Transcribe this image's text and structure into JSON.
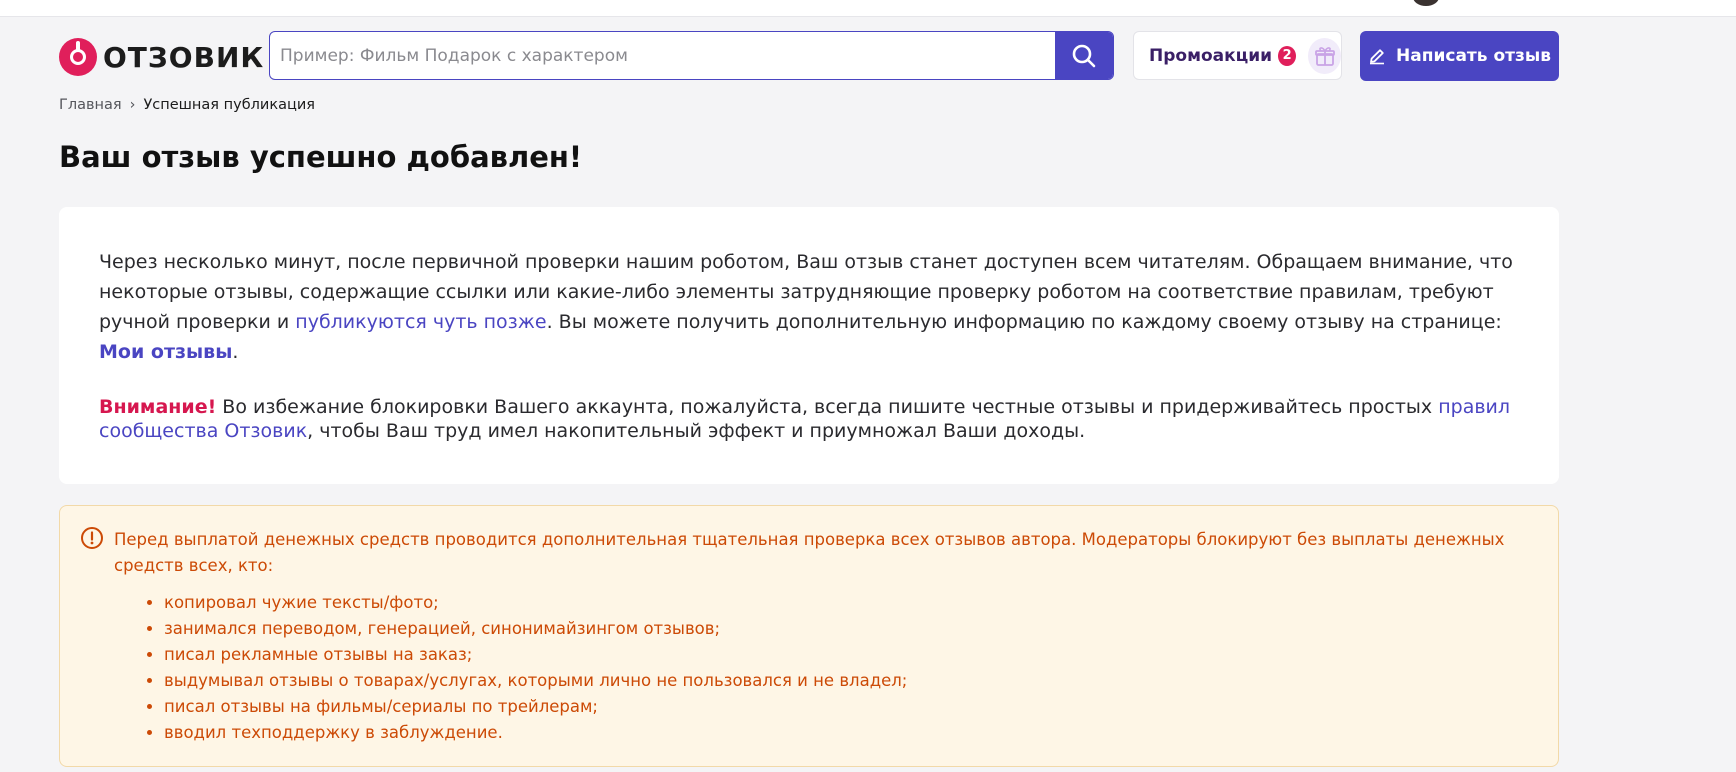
{
  "logo": {
    "text": "ОТЗОВИК"
  },
  "search": {
    "placeholder": "Пример: Фильм Подарок с характером"
  },
  "promo": {
    "label": "Промоакции",
    "count": "2"
  },
  "write_button": {
    "label": "Написать отзыв"
  },
  "breadcrumb": {
    "home": "Главная",
    "separator": "›",
    "current": "Успешная публикация"
  },
  "page_title": "Ваш отзыв успешно добавлен!",
  "info": {
    "p1_part1": "Через несколько минут, после первичной проверки нашим роботом, Ваш отзыв станет доступен всем читателям. Обращаем внимание, что некоторые отзывы, содержащие ссылки или какие-либо элементы затрудняющие проверку роботом на соответствие правилам, требуют ручной проверки и ",
    "p1_link": "публикуются чуть позже",
    "p1_part2": ". Вы можете получить дополнительную информацию по каждому своему отзыву на странице: ",
    "my_reviews_link": "Мои отзывы",
    "p1_end": ".",
    "attention_label": "Внимание!",
    "p2_part1": " Во избежание блокировки Вашего аккаунта, пожалуйста, всегда пишите честные отзывы и придерживайтесь простых ",
    "rules_link": "правил сообщества Отзовик",
    "p2_part2": ", чтобы Ваш труд имел накопительный эффект и приумножал Ваши доходы."
  },
  "warning": {
    "intro": "Перед выплатой денежных средств проводится дополнительная тщательная проверка всех отзывов автора. Модераторы блокируют без выплаты денежных средств всех, кто:",
    "items": [
      "копировал чужие тексты/фото;",
      "занимался переводом, генерацией, синонимайзингом отзывов;",
      "писал рекламные отзывы на заказ;",
      "выдумывал отзывы о товарах/услугах, которыми лично не пользовался и не владел;",
      "писал отзывы на фильмы/сериалы по трейлерам;",
      "вводил техподдержку в заблуждение."
    ]
  },
  "colors": {
    "accent": "#4a45c2",
    "brand": "#e01f5b",
    "warning_text": "#cc4a06",
    "warning_bg": "#fef6e6"
  }
}
